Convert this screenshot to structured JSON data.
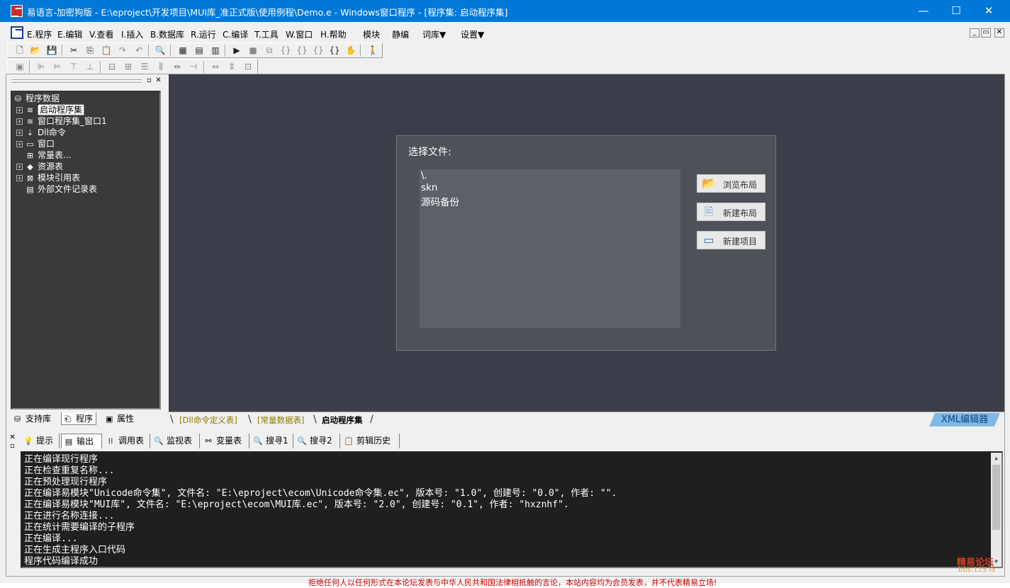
{
  "window": {
    "title": "易语言-加密狗版 - E:\\eproject\\开发项目\\MUI库_准正式版\\使用例程\\Demo.e - Windows窗口程序 - [程序集: 启动程序集]",
    "controls": [
      "—",
      "☐",
      "✕"
    ]
  },
  "menu": {
    "items": [
      "E.程序",
      "E.编辑",
      "V.查看",
      "I.插入",
      "B.数据库",
      "R.运行",
      "C.编译",
      "T.工具",
      "W.窗口",
      "H.帮助",
      "模块",
      "静编",
      "词库▼",
      "设置▼"
    ],
    "mdi_controls": [
      "_",
      "▭",
      "✕"
    ]
  },
  "left_panel": {
    "tree_root": "程序数据",
    "tree_items": [
      "启动程序集",
      "窗口程序集_窗口1",
      "Dll命令",
      "窗口",
      "常量表...",
      "资源表",
      "模块引用表",
      "外部文件记录表"
    ],
    "tabs": [
      "支持库",
      "程序",
      "属性"
    ]
  },
  "dialog": {
    "title": "选择文件:",
    "files": [
      "\\.",
      "skn",
      "源码备份"
    ],
    "buttons": [
      "浏览布局",
      "新建布局",
      "新建项目"
    ]
  },
  "doc_tabs": [
    "[Dll命令定义表]",
    "[常量数据表]",
    "启动程序集"
  ],
  "xml_tab": "XML编辑器",
  "output": {
    "tabs": [
      "提示",
      "输出",
      "调用表",
      "监视表",
      "变量表",
      "搜寻1",
      "搜寻2",
      "剪辑历史"
    ],
    "lines": [
      "正在编译现行程序",
      "正在检查重复名称...",
      "正在预处理现行程序",
      "正在编译易模块\"Unicode命令集\", 文件名: \"E:\\eproject\\ecom\\Unicode命令集.ec\", 版本号: \"1.0\", 创建号: \"0.0\", 作者: \"\".",
      "正在编译易模块\"MUI库\", 文件名: \"E:\\eproject\\ecom\\MUI库.ec\", 版本号: \"2.0\", 创建号: \"0.1\", 作者: \"hxznhf\".",
      "正在进行名称连接...",
      "正在统计需要编译的子程序",
      "正在编译...",
      "正在生成主程序入口代码",
      "程序代码编译成功"
    ]
  },
  "watermark": {
    "name": "精易论坛",
    "url": "bbs.125.la"
  },
  "footer_notice": "拒绝任何人以任何形式在本论坛发表与中华人民共和国法律相抵触的言论，本站内容均为会员发表，并不代表精易立场!"
}
